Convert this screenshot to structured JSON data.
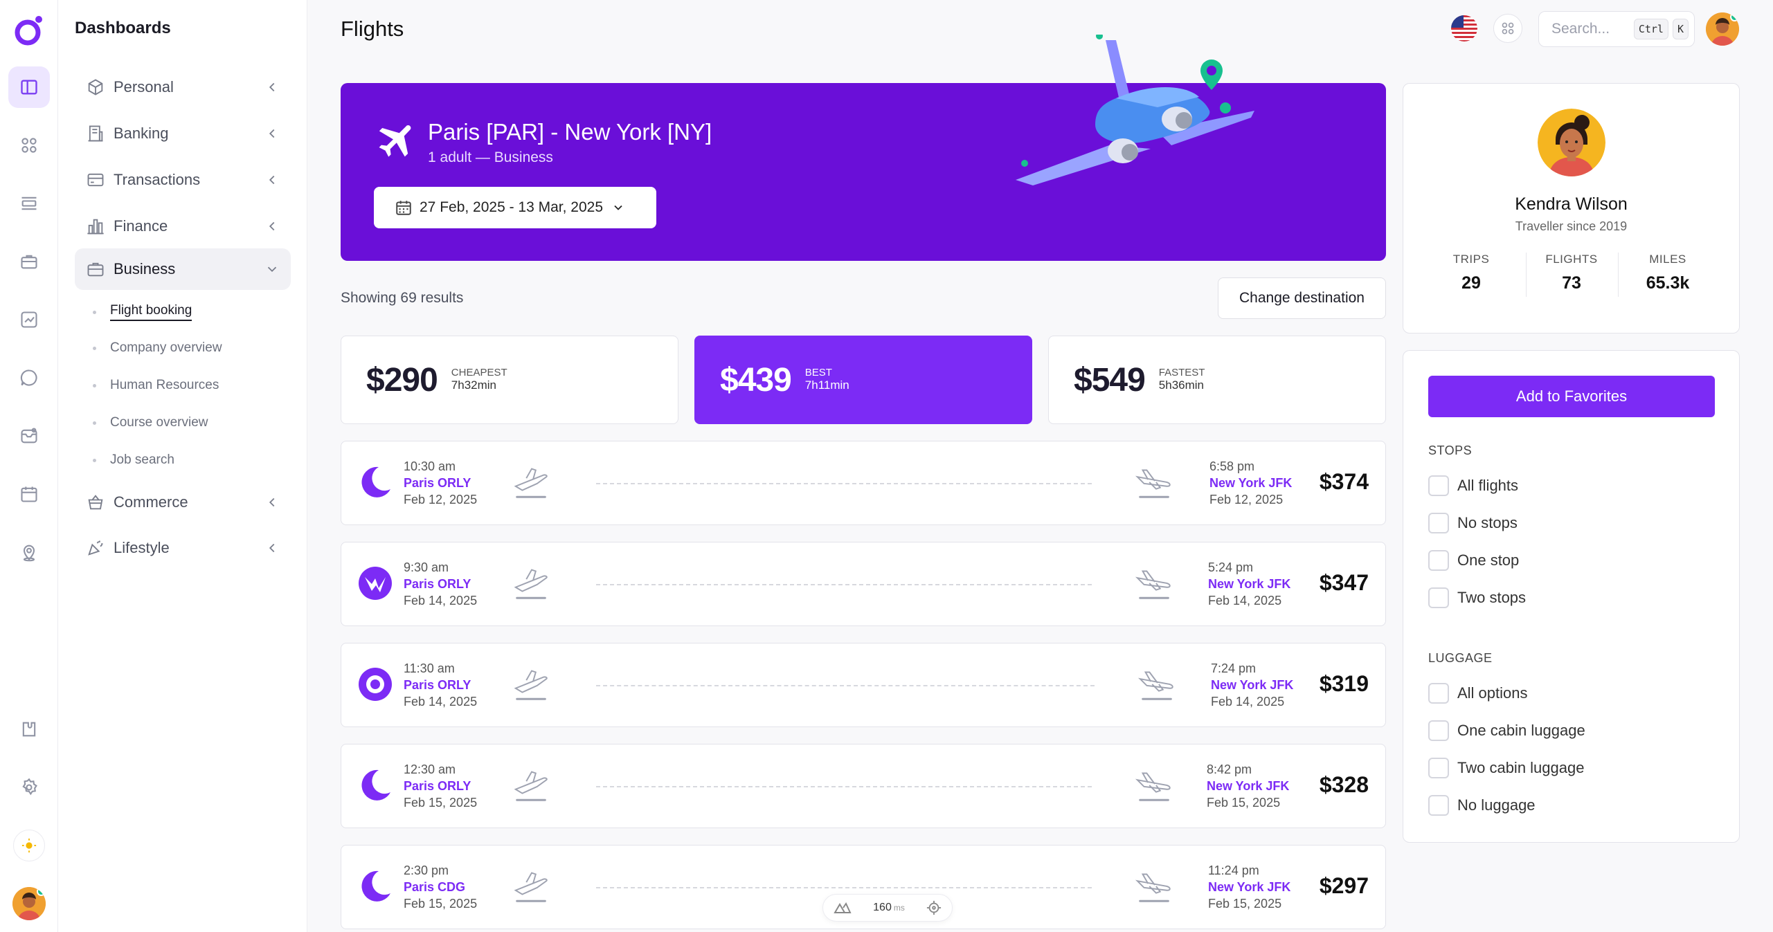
{
  "sidebar": {
    "title": "Dashboards",
    "items": [
      {
        "label": "Personal",
        "icon": "cube-icon"
      },
      {
        "label": "Banking",
        "icon": "bank-icon"
      },
      {
        "label": "Transactions",
        "icon": "card-icon"
      },
      {
        "label": "Finance",
        "icon": "chart-bars-icon"
      },
      {
        "label": "Business",
        "icon": "briefcase-icon"
      },
      {
        "label": "Commerce",
        "icon": "basket-icon"
      },
      {
        "label": "Lifestyle",
        "icon": "party-icon"
      }
    ],
    "business_sub": [
      "Flight booking",
      "Company overview",
      "Human Resources",
      "Course overview",
      "Job search"
    ]
  },
  "header": {
    "title": "Flights",
    "search_placeholder": "Search...",
    "kbd_ctrl": "Ctrl",
    "kbd_k": "K"
  },
  "hero": {
    "route": "Paris [PAR] - New York [NY]",
    "passengers": "1 adult — Business",
    "dates": "27 Feb, 2025 - 13 Mar, 2025"
  },
  "results": {
    "count_text": "Showing 69 results",
    "change_button": "Change destination"
  },
  "price_cards": [
    {
      "amount": "$290",
      "label": "CHEAPEST",
      "duration": "7h32min"
    },
    {
      "amount": "$439",
      "label": "BEST",
      "duration": "7h11min"
    },
    {
      "amount": "$549",
      "label": "FASTEST",
      "duration": "5h36min"
    }
  ],
  "flights": [
    {
      "dep_time": "10:30 am",
      "dep_city": "Paris ORLY",
      "dep_date": "Feb 12, 2025",
      "arr_time": "6:58 pm",
      "arr_city": "New York JFK",
      "arr_date": "Feb 12, 2025",
      "price": "$374"
    },
    {
      "dep_time": "9:30 am",
      "dep_city": "Paris ORLY",
      "dep_date": "Feb 14, 2025",
      "arr_time": "5:24 pm",
      "arr_city": "New York JFK",
      "arr_date": "Feb 14, 2025",
      "price": "$347"
    },
    {
      "dep_time": "11:30 am",
      "dep_city": "Paris ORLY",
      "dep_date": "Feb 14, 2025",
      "arr_time": "7:24 pm",
      "arr_city": "New York JFK",
      "arr_date": "Feb 14, 2025",
      "price": "$319"
    },
    {
      "dep_time": "12:30 am",
      "dep_city": "Paris ORLY",
      "dep_date": "Feb 15, 2025",
      "arr_time": "8:42 pm",
      "arr_city": "New York JFK",
      "arr_date": "Feb 15, 2025",
      "price": "$328"
    },
    {
      "dep_time": "2:30 pm",
      "dep_city": "Paris CDG",
      "dep_date": "Feb 15, 2025",
      "arr_time": "11:24 pm",
      "arr_city": "New York JFK",
      "arr_date": "Feb 15, 2025",
      "price": "$297"
    }
  ],
  "profile": {
    "name": "Kendra Wilson",
    "since": "Traveller since 2019",
    "stats": [
      {
        "label": "TRIPS",
        "value": "29"
      },
      {
        "label": "FLIGHTS",
        "value": "73"
      },
      {
        "label": "MILES",
        "value": "65.3k"
      }
    ]
  },
  "filters": {
    "favorites_button": "Add to Favorites",
    "stops_heading": "STOPS",
    "stops": [
      "All flights",
      "No stops",
      "One stop",
      "Two stops"
    ],
    "luggage_heading": "LUGGAGE",
    "luggage": [
      "All options",
      "One cabin luggage",
      "Two cabin luggage",
      "No luggage"
    ]
  },
  "devbar": {
    "value": "160",
    "unit": "ms"
  },
  "colors": {
    "accent": "#7c2bf5",
    "hero": "#6a0fd8",
    "teal": "#18c08f"
  }
}
